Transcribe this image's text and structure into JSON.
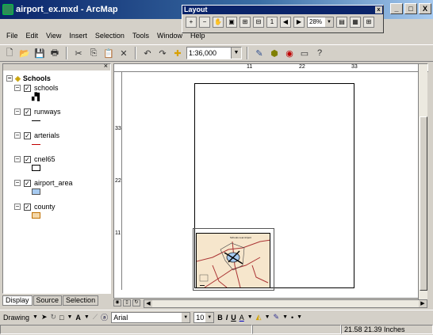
{
  "window": {
    "title": "airport_ex.mxd - ArcMap",
    "minimize": "_",
    "maximize": "□",
    "close": "X"
  },
  "menu": [
    "File",
    "Edit",
    "View",
    "Insert",
    "Selection",
    "Tools",
    "Window",
    "Help"
  ],
  "toolbar": {
    "scale_value": "1:36,000",
    "icons": [
      "new-icon",
      "open-icon",
      "save-icon",
      "print-icon",
      "cut-icon",
      "copy-icon",
      "paste-icon",
      "delete-icon",
      "undo-icon",
      "redo-icon",
      "add-data-icon"
    ]
  },
  "layout_toolbar": {
    "title": "Layout",
    "close": "x",
    "zoom_value": "28%"
  },
  "toc": {
    "close": "×",
    "root_label": "Schools",
    "layers": [
      {
        "label": "schools",
        "symbol": "point",
        "color": "#1a1a1a"
      },
      {
        "label": "runways",
        "symbol": "line",
        "color": "#000000"
      },
      {
        "label": "arterials",
        "symbol": "line",
        "color": "#c00000"
      },
      {
        "label": "cnel65",
        "symbol": "poly",
        "fill": "#ffffff",
        "stroke": "#000000"
      },
      {
        "label": "airport_area",
        "symbol": "poly",
        "fill": "#a6caf0",
        "stroke": "#555555"
      },
      {
        "label": "county",
        "symbol": "poly",
        "fill": "#f4d7a8",
        "stroke": "#c07000"
      }
    ],
    "tabs": [
      "Display",
      "Source",
      "Selection"
    ]
  },
  "rulers": {
    "h_labels": [
      "11",
      "22",
      "33"
    ],
    "v_labels": [
      "33",
      "22",
      "11"
    ]
  },
  "layout_page": {
    "map_title": "Schools near Airport"
  },
  "drawbar": {
    "drawing_label": "Drawing",
    "font_name": "Arial",
    "font_size": "10",
    "bold": "B",
    "italic": "I",
    "underline": "U",
    "text_a": "A"
  },
  "status": {
    "coords": "21.58  21.39 Inches"
  }
}
